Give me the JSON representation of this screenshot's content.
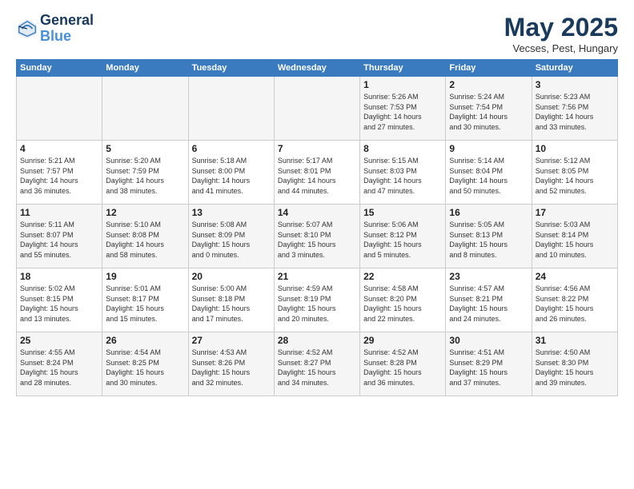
{
  "header": {
    "logo_line1": "General",
    "logo_line2": "Blue",
    "title": "May 2025",
    "subtitle": "Vecses, Pest, Hungary"
  },
  "days_of_week": [
    "Sunday",
    "Monday",
    "Tuesday",
    "Wednesday",
    "Thursday",
    "Friday",
    "Saturday"
  ],
  "weeks": [
    [
      {
        "day": "",
        "content": ""
      },
      {
        "day": "",
        "content": ""
      },
      {
        "day": "",
        "content": ""
      },
      {
        "day": "",
        "content": ""
      },
      {
        "day": "1",
        "content": "Sunrise: 5:26 AM\nSunset: 7:53 PM\nDaylight: 14 hours\nand 27 minutes."
      },
      {
        "day": "2",
        "content": "Sunrise: 5:24 AM\nSunset: 7:54 PM\nDaylight: 14 hours\nand 30 minutes."
      },
      {
        "day": "3",
        "content": "Sunrise: 5:23 AM\nSunset: 7:56 PM\nDaylight: 14 hours\nand 33 minutes."
      }
    ],
    [
      {
        "day": "4",
        "content": "Sunrise: 5:21 AM\nSunset: 7:57 PM\nDaylight: 14 hours\nand 36 minutes."
      },
      {
        "day": "5",
        "content": "Sunrise: 5:20 AM\nSunset: 7:59 PM\nDaylight: 14 hours\nand 38 minutes."
      },
      {
        "day": "6",
        "content": "Sunrise: 5:18 AM\nSunset: 8:00 PM\nDaylight: 14 hours\nand 41 minutes."
      },
      {
        "day": "7",
        "content": "Sunrise: 5:17 AM\nSunset: 8:01 PM\nDaylight: 14 hours\nand 44 minutes."
      },
      {
        "day": "8",
        "content": "Sunrise: 5:15 AM\nSunset: 8:03 PM\nDaylight: 14 hours\nand 47 minutes."
      },
      {
        "day": "9",
        "content": "Sunrise: 5:14 AM\nSunset: 8:04 PM\nDaylight: 14 hours\nand 50 minutes."
      },
      {
        "day": "10",
        "content": "Sunrise: 5:12 AM\nSunset: 8:05 PM\nDaylight: 14 hours\nand 52 minutes."
      }
    ],
    [
      {
        "day": "11",
        "content": "Sunrise: 5:11 AM\nSunset: 8:07 PM\nDaylight: 14 hours\nand 55 minutes."
      },
      {
        "day": "12",
        "content": "Sunrise: 5:10 AM\nSunset: 8:08 PM\nDaylight: 14 hours\nand 58 minutes."
      },
      {
        "day": "13",
        "content": "Sunrise: 5:08 AM\nSunset: 8:09 PM\nDaylight: 15 hours\nand 0 minutes."
      },
      {
        "day": "14",
        "content": "Sunrise: 5:07 AM\nSunset: 8:10 PM\nDaylight: 15 hours\nand 3 minutes."
      },
      {
        "day": "15",
        "content": "Sunrise: 5:06 AM\nSunset: 8:12 PM\nDaylight: 15 hours\nand 5 minutes."
      },
      {
        "day": "16",
        "content": "Sunrise: 5:05 AM\nSunset: 8:13 PM\nDaylight: 15 hours\nand 8 minutes."
      },
      {
        "day": "17",
        "content": "Sunrise: 5:03 AM\nSunset: 8:14 PM\nDaylight: 15 hours\nand 10 minutes."
      }
    ],
    [
      {
        "day": "18",
        "content": "Sunrise: 5:02 AM\nSunset: 8:15 PM\nDaylight: 15 hours\nand 13 minutes."
      },
      {
        "day": "19",
        "content": "Sunrise: 5:01 AM\nSunset: 8:17 PM\nDaylight: 15 hours\nand 15 minutes."
      },
      {
        "day": "20",
        "content": "Sunrise: 5:00 AM\nSunset: 8:18 PM\nDaylight: 15 hours\nand 17 minutes."
      },
      {
        "day": "21",
        "content": "Sunrise: 4:59 AM\nSunset: 8:19 PM\nDaylight: 15 hours\nand 20 minutes."
      },
      {
        "day": "22",
        "content": "Sunrise: 4:58 AM\nSunset: 8:20 PM\nDaylight: 15 hours\nand 22 minutes."
      },
      {
        "day": "23",
        "content": "Sunrise: 4:57 AM\nSunset: 8:21 PM\nDaylight: 15 hours\nand 24 minutes."
      },
      {
        "day": "24",
        "content": "Sunrise: 4:56 AM\nSunset: 8:22 PM\nDaylight: 15 hours\nand 26 minutes."
      }
    ],
    [
      {
        "day": "25",
        "content": "Sunrise: 4:55 AM\nSunset: 8:24 PM\nDaylight: 15 hours\nand 28 minutes."
      },
      {
        "day": "26",
        "content": "Sunrise: 4:54 AM\nSunset: 8:25 PM\nDaylight: 15 hours\nand 30 minutes."
      },
      {
        "day": "27",
        "content": "Sunrise: 4:53 AM\nSunset: 8:26 PM\nDaylight: 15 hours\nand 32 minutes."
      },
      {
        "day": "28",
        "content": "Sunrise: 4:52 AM\nSunset: 8:27 PM\nDaylight: 15 hours\nand 34 minutes."
      },
      {
        "day": "29",
        "content": "Sunrise: 4:52 AM\nSunset: 8:28 PM\nDaylight: 15 hours\nand 36 minutes."
      },
      {
        "day": "30",
        "content": "Sunrise: 4:51 AM\nSunset: 8:29 PM\nDaylight: 15 hours\nand 37 minutes."
      },
      {
        "day": "31",
        "content": "Sunrise: 4:50 AM\nSunset: 8:30 PM\nDaylight: 15 hours\nand 39 minutes."
      }
    ]
  ]
}
